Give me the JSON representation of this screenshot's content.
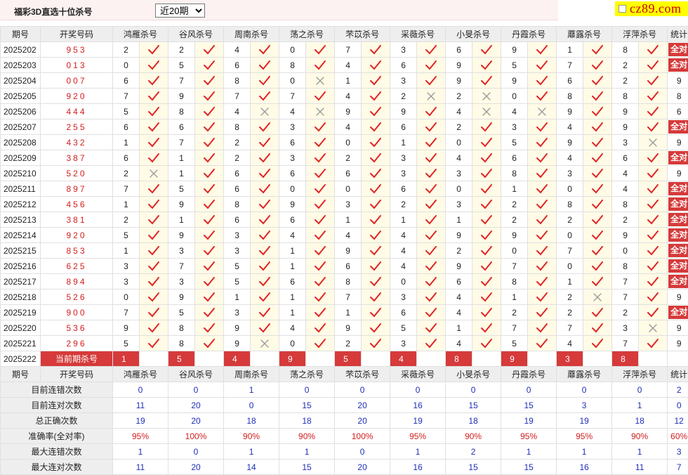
{
  "header": {
    "title": "福彩3D直选十位杀号",
    "period_selected": "近20期",
    "period_options": [
      "近20期"
    ],
    "brand": "cz89.com"
  },
  "columns": {
    "period": "期号",
    "draw": "开奖号码",
    "experts": [
      "鸿雁杀号",
      "谷风杀号",
      "周南杀号",
      "荡之杀号",
      "芣苡杀号",
      "采薇杀号",
      "小旻杀号",
      "丹霞杀号",
      "蘼露杀号",
      "浮萍杀号"
    ],
    "stat": "统计"
  },
  "rows": [
    {
      "period": "2025202",
      "draw": "953",
      "kills": [
        2,
        2,
        4,
        0,
        7,
        3,
        6,
        9,
        1,
        8
      ],
      "ok": [
        1,
        1,
        1,
        1,
        1,
        1,
        1,
        1,
        1,
        1
      ],
      "stat": "全对"
    },
    {
      "period": "2025203",
      "draw": "013",
      "kills": [
        0,
        5,
        6,
        8,
        4,
        6,
        9,
        5,
        7,
        2
      ],
      "ok": [
        1,
        1,
        1,
        1,
        1,
        1,
        1,
        1,
        1,
        1
      ],
      "stat": "全对"
    },
    {
      "period": "2025204",
      "draw": "007",
      "kills": [
        6,
        7,
        8,
        0,
        1,
        3,
        9,
        9,
        6,
        2
      ],
      "ok": [
        1,
        1,
        1,
        0,
        1,
        1,
        1,
        1,
        1,
        1
      ],
      "stat": "9"
    },
    {
      "period": "2025205",
      "draw": "920",
      "kills": [
        7,
        9,
        7,
        7,
        4,
        2,
        2,
        0,
        8,
        8
      ],
      "ok": [
        1,
        1,
        1,
        1,
        1,
        0,
        0,
        1,
        1,
        1
      ],
      "stat": "8"
    },
    {
      "period": "2025206",
      "draw": "444",
      "kills": [
        5,
        8,
        4,
        4,
        9,
        9,
        4,
        4,
        9,
        9
      ],
      "ok": [
        1,
        1,
        0,
        0,
        1,
        1,
        0,
        0,
        1,
        1
      ],
      "stat": "6"
    },
    {
      "period": "2025207",
      "draw": "255",
      "kills": [
        6,
        6,
        8,
        3,
        4,
        6,
        2,
        3,
        4,
        9
      ],
      "ok": [
        1,
        1,
        1,
        1,
        1,
        1,
        1,
        1,
        1,
        1
      ],
      "stat": "全对"
    },
    {
      "period": "2025208",
      "draw": "432",
      "kills": [
        1,
        7,
        2,
        6,
        0,
        1,
        0,
        5,
        9,
        3
      ],
      "ok": [
        1,
        1,
        1,
        1,
        1,
        1,
        1,
        1,
        1,
        0
      ],
      "stat": "9"
    },
    {
      "period": "2025209",
      "draw": "387",
      "kills": [
        6,
        1,
        2,
        3,
        2,
        3,
        4,
        6,
        4,
        6
      ],
      "ok": [
        1,
        1,
        1,
        1,
        1,
        1,
        1,
        1,
        1,
        1
      ],
      "stat": "全对"
    },
    {
      "period": "2025210",
      "draw": "520",
      "kills": [
        2,
        1,
        6,
        6,
        6,
        3,
        3,
        8,
        3,
        4
      ],
      "ok": [
        0,
        1,
        1,
        1,
        1,
        1,
        1,
        1,
        1,
        1
      ],
      "stat": "9"
    },
    {
      "period": "2025211",
      "draw": "897",
      "kills": [
        7,
        5,
        6,
        0,
        0,
        6,
        0,
        1,
        0,
        4
      ],
      "ok": [
        1,
        1,
        1,
        1,
        1,
        1,
        1,
        1,
        1,
        1
      ],
      "stat": "全对"
    },
    {
      "period": "2025212",
      "draw": "456",
      "kills": [
        1,
        9,
        8,
        9,
        3,
        2,
        3,
        2,
        8,
        8
      ],
      "ok": [
        1,
        1,
        1,
        1,
        1,
        1,
        1,
        1,
        1,
        1
      ],
      "stat": "全对"
    },
    {
      "period": "2025213",
      "draw": "381",
      "kills": [
        2,
        1,
        6,
        6,
        1,
        1,
        1,
        2,
        2,
        2
      ],
      "ok": [
        1,
        1,
        1,
        1,
        1,
        1,
        1,
        1,
        1,
        1
      ],
      "stat": "全对"
    },
    {
      "period": "2025214",
      "draw": "920",
      "kills": [
        5,
        9,
        3,
        4,
        4,
        4,
        9,
        9,
        0,
        9
      ],
      "ok": [
        1,
        1,
        1,
        1,
        1,
        1,
        1,
        1,
        1,
        1
      ],
      "stat": "全对"
    },
    {
      "period": "2025215",
      "draw": "853",
      "kills": [
        1,
        3,
        3,
        1,
        9,
        4,
        2,
        0,
        7,
        0
      ],
      "ok": [
        1,
        1,
        1,
        1,
        1,
        1,
        1,
        1,
        1,
        1
      ],
      "stat": "全对"
    },
    {
      "period": "2025216",
      "draw": "625",
      "kills": [
        3,
        7,
        5,
        1,
        6,
        4,
        9,
        7,
        0,
        8
      ],
      "ok": [
        1,
        1,
        1,
        1,
        1,
        1,
        1,
        1,
        1,
        1
      ],
      "stat": "全对"
    },
    {
      "period": "2025217",
      "draw": "894",
      "kills": [
        3,
        3,
        5,
        6,
        8,
        0,
        6,
        8,
        1,
        7
      ],
      "ok": [
        1,
        1,
        1,
        1,
        1,
        1,
        1,
        1,
        1,
        1
      ],
      "stat": "全对"
    },
    {
      "period": "2025218",
      "draw": "526",
      "kills": [
        0,
        9,
        1,
        1,
        7,
        3,
        4,
        1,
        2,
        7
      ],
      "ok": [
        1,
        1,
        1,
        1,
        1,
        1,
        1,
        1,
        0,
        1
      ],
      "stat": "9"
    },
    {
      "period": "2025219",
      "draw": "900",
      "kills": [
        7,
        5,
        3,
        1,
        1,
        6,
        4,
        2,
        2,
        2
      ],
      "ok": [
        1,
        1,
        1,
        1,
        1,
        1,
        1,
        1,
        1,
        1
      ],
      "stat": "全对"
    },
    {
      "period": "2025220",
      "draw": "536",
      "kills": [
        9,
        8,
        9,
        4,
        9,
        5,
        1,
        7,
        7,
        3
      ],
      "ok": [
        1,
        1,
        1,
        1,
        1,
        1,
        1,
        1,
        1,
        0
      ],
      "stat": "9"
    },
    {
      "period": "2025221",
      "draw": "296",
      "kills": [
        5,
        8,
        9,
        0,
        2,
        3,
        4,
        5,
        4,
        7
      ],
      "ok": [
        1,
        1,
        0,
        1,
        1,
        1,
        1,
        1,
        1,
        1
      ],
      "stat": "9"
    }
  ],
  "current": {
    "period": "2025222",
    "label": "当前期杀号",
    "kills": [
      1,
      5,
      4,
      9,
      5,
      4,
      8,
      9,
      3,
      8
    ]
  },
  "stats": [
    {
      "label": "目前连错次数",
      "values": [
        "0",
        "0",
        "1",
        "0",
        "0",
        "0",
        "0",
        "0",
        "0",
        "0"
      ],
      "stat": "2",
      "pct": false
    },
    {
      "label": "目前连对次数",
      "values": [
        "11",
        "20",
        "0",
        "15",
        "20",
        "16",
        "15",
        "15",
        "3",
        "1"
      ],
      "stat": "0",
      "pct": false
    },
    {
      "label": "总正确次数",
      "values": [
        "19",
        "20",
        "18",
        "18",
        "20",
        "19",
        "18",
        "19",
        "19",
        "18"
      ],
      "stat": "12",
      "pct": false
    },
    {
      "label": "准确率(全对率)",
      "values": [
        "95%",
        "100%",
        "90%",
        "90%",
        "100%",
        "95%",
        "90%",
        "95%",
        "95%",
        "90%"
      ],
      "stat": "60%",
      "pct": true
    },
    {
      "label": "最大连错次数",
      "values": [
        "1",
        "0",
        "1",
        "1",
        "0",
        "1",
        "2",
        "1",
        "1",
        "1"
      ],
      "stat": "3",
      "pct": false
    },
    {
      "label": "最大连对次数",
      "values": [
        "11",
        "20",
        "14",
        "15",
        "20",
        "16",
        "15",
        "15",
        "16",
        "11"
      ],
      "stat": "7",
      "pct": false
    }
  ],
  "colors": {
    "accent_red": "#d63a3a",
    "check_red": "#e02424",
    "stat_blue": "#1e2fb8",
    "mark_bg": "#fffbe6",
    "brand_bg": "#ffff00"
  }
}
